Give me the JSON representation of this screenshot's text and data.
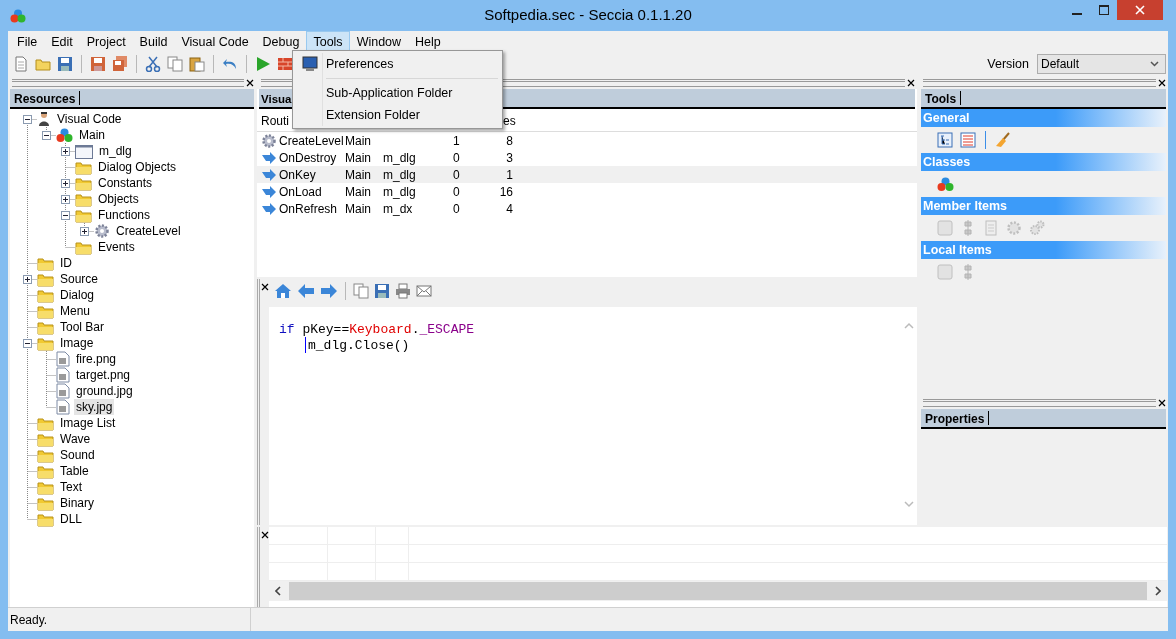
{
  "window": {
    "title": "Softpedia.sec - Seccia 0.1.1.20"
  },
  "menu": [
    {
      "label": "File",
      "selected": false
    },
    {
      "label": "Edit",
      "selected": false
    },
    {
      "label": "Project",
      "selected": false
    },
    {
      "label": "Build",
      "selected": false
    },
    {
      "label": "Visual Code",
      "selected": false
    },
    {
      "label": "Debug",
      "selected": false
    },
    {
      "label": "Tools",
      "selected": true
    },
    {
      "label": "Window",
      "selected": false
    },
    {
      "label": "Help",
      "selected": false
    }
  ],
  "tools_menu": [
    {
      "kind": "iconitem",
      "label": "Preferences"
    },
    {
      "kind": "separator"
    },
    {
      "kind": "item",
      "label": "Sub-Application Folder"
    },
    {
      "kind": "item",
      "label": "Extension Folder"
    }
  ],
  "version": {
    "label": "Version",
    "value": "Default"
  },
  "resources": {
    "title": "Resources",
    "tree": [
      {
        "label": "Visual Code",
        "kind": "person",
        "expanded": true,
        "selected": false,
        "children": [
          {
            "label": "Main",
            "kind": "classes",
            "expanded": true,
            "selected": false,
            "children": [
              {
                "label": "m_dlg",
                "kind": "window",
                "expanded": false,
                "selected": false
              },
              {
                "label": "Dialog Objects",
                "kind": "folder",
                "selected": false
              },
              {
                "label": "Constants",
                "kind": "folder",
                "expanded": false,
                "selected": false
              },
              {
                "label": "Objects",
                "kind": "folder",
                "expanded": false,
                "selected": false
              },
              {
                "label": "Functions",
                "kind": "folder",
                "expanded": true,
                "selected": false,
                "children": [
                  {
                    "label": "CreateLevel",
                    "kind": "gear",
                    "expanded": false,
                    "selected": false
                  }
                ]
              },
              {
                "label": "Events",
                "kind": "folder",
                "selected": false
              }
            ]
          }
        ]
      },
      {
        "label": "ID",
        "kind": "folder",
        "selected": false
      },
      {
        "label": "Source",
        "kind": "folder",
        "expanded": false,
        "selected": false
      },
      {
        "label": "Dialog",
        "kind": "folder",
        "selected": false
      },
      {
        "label": "Menu",
        "kind": "folder",
        "selected": false
      },
      {
        "label": "Tool Bar",
        "kind": "folder",
        "selected": false
      },
      {
        "label": "Image",
        "kind": "folder",
        "expanded": true,
        "selected": false,
        "children": [
          {
            "label": "fire.png",
            "kind": "file",
            "selected": false
          },
          {
            "label": "target.png",
            "kind": "file",
            "selected": false
          },
          {
            "label": "ground.jpg",
            "kind": "file",
            "selected": false
          },
          {
            "label": "sky.jpg",
            "kind": "file",
            "selected": true
          }
        ]
      },
      {
        "label": "Image List",
        "kind": "folder",
        "selected": false
      },
      {
        "label": "Wave",
        "kind": "folder",
        "selected": false
      },
      {
        "label": "Sound",
        "kind": "folder",
        "selected": false
      },
      {
        "label": "Table",
        "kind": "folder",
        "selected": false
      },
      {
        "label": "Text",
        "kind": "folder",
        "selected": false
      },
      {
        "label": "Binary",
        "kind": "folder",
        "selected": false
      },
      {
        "label": "DLL",
        "kind": "folder",
        "selected": false
      }
    ]
  },
  "visual_code": {
    "tab": "Visua",
    "columns": [
      "Routi",
      "es"
    ],
    "rows": [
      {
        "kind": "gear",
        "column_1": "CreateLevel",
        "column_2": "Main",
        "column_4": "1",
        "column_5": "8",
        "selected": false
      },
      {
        "kind": "arrow",
        "column_1": "OnDestroy",
        "column_2": "Main",
        "column_3": "m_dlg",
        "column_4": "0",
        "column_5": "3",
        "selected": false
      },
      {
        "kind": "arrow",
        "column_1": "OnKey",
        "column_2": "Main",
        "column_3": "m_dlg",
        "column_4": "0",
        "column_5": "1",
        "selected": true
      },
      {
        "kind": "arrow",
        "column_1": "OnLoad",
        "column_2": "Main",
        "column_3": "m_dlg",
        "column_4": "0",
        "column_5": "16",
        "selected": false
      },
      {
        "kind": "arrow",
        "column_1": "OnRefresh",
        "column_2": "Main",
        "column_3": "m_dx",
        "column_4": "0",
        "column_5": "4",
        "selected": false
      }
    ]
  },
  "editor": {
    "lines": [
      {
        "caret": false,
        "tokens": [
          {
            "kind": "keyword",
            "text": "if"
          },
          {
            "kind": "plain",
            "text": " pKey=="
          },
          {
            "kind": "class",
            "text": "Keyboard"
          },
          {
            "kind": "plain",
            "text": "."
          },
          {
            "kind": "constant",
            "text": "_ESCAPE"
          }
        ]
      },
      {
        "caret": true,
        "tokens": [
          {
            "kind": "plain",
            "text": "m_dlg.Close()"
          }
        ]
      }
    ]
  },
  "tools_panel": {
    "title": "Tools",
    "sections": [
      {
        "kind": "general",
        "title": "General",
        "disabled": false
      },
      {
        "kind": "classes",
        "title": "Classes",
        "disabled": false
      },
      {
        "kind": "member",
        "title": "Member Items",
        "disabled": true
      },
      {
        "kind": "local",
        "title": "Local Items",
        "disabled": true
      }
    ]
  },
  "properties": {
    "title": "Properties"
  },
  "status": "Ready."
}
